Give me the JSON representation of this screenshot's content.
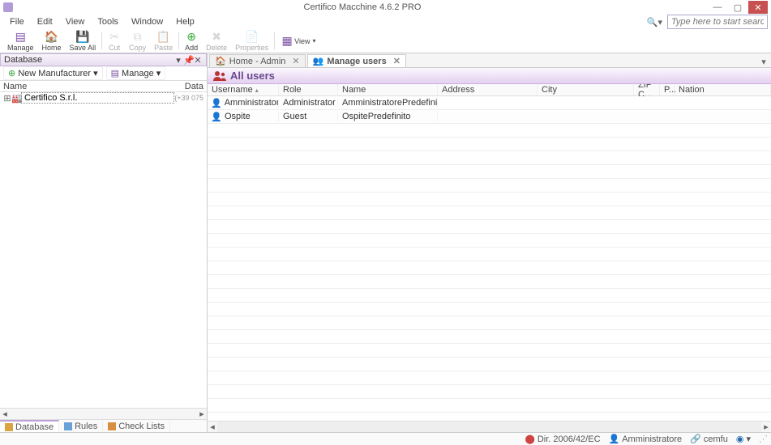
{
  "title": "Certifico Macchine 4.6.2 PRO",
  "menu": [
    "File",
    "Edit",
    "View",
    "Tools",
    "Window",
    "Help"
  ],
  "search": {
    "placeholder": "Type here to start searching"
  },
  "toolbar": [
    {
      "key": "manage",
      "label": "Manage",
      "icon": "list",
      "color": "#7a4fa3"
    },
    {
      "key": "home",
      "label": "Home",
      "icon": "home",
      "color": "#888"
    },
    {
      "key": "saveall",
      "label": "Save All",
      "icon": "disks",
      "color": "#7a4fa3"
    },
    {
      "key": "sep"
    },
    {
      "key": "cut",
      "label": "Cut",
      "icon": "cut",
      "color": "#aaa",
      "disabled": true
    },
    {
      "key": "copy",
      "label": "Copy",
      "icon": "copy",
      "color": "#aaa",
      "disabled": true
    },
    {
      "key": "paste",
      "label": "Paste",
      "icon": "paste",
      "color": "#aaa",
      "disabled": true
    },
    {
      "key": "sep"
    },
    {
      "key": "add",
      "label": "Add",
      "icon": "plus",
      "color": "#3a3"
    },
    {
      "key": "delete",
      "label": "Delete",
      "icon": "x",
      "color": "#aaa",
      "disabled": true
    },
    {
      "key": "properties",
      "label": "Properties",
      "icon": "props",
      "color": "#aaa",
      "disabled": true
    },
    {
      "key": "sep"
    },
    {
      "key": "view",
      "label": "View",
      "icon": "grid",
      "color": "#7a4fa3",
      "dd": true
    }
  ],
  "leftPanel": {
    "title": "Database",
    "sub": {
      "newmfr": "New Manufacturer",
      "manage": "Manage"
    },
    "cols": {
      "name": "Name",
      "data": "Data"
    },
    "tree": [
      {
        "label": "Certifico S.r.l.",
        "data": "(+39 075"
      }
    ],
    "tabs": [
      {
        "key": "database",
        "label": "Database",
        "active": true,
        "color": "#d9a441"
      },
      {
        "key": "rules",
        "label": "Rules",
        "active": false,
        "color": "#6aa0d8"
      },
      {
        "key": "checklists",
        "label": "Check Lists",
        "active": false,
        "color": "#d98f41"
      }
    ]
  },
  "docTabs": [
    {
      "key": "home",
      "label": "Home - Admin",
      "icon": "home",
      "active": false
    },
    {
      "key": "users",
      "label": "Manage users",
      "icon": "users",
      "active": true
    }
  ],
  "section": {
    "title": "All users"
  },
  "grid": {
    "columns": [
      "Username",
      "Role",
      "Name",
      "Address",
      "City",
      "ZIP C...",
      "P...",
      "Nation"
    ],
    "rows": [
      {
        "username": "Amministratore",
        "role": "Administrator",
        "name": "AmministratorePredefinito"
      },
      {
        "username": "Ospite",
        "role": "Guest",
        "name": "OspitePredefinito"
      }
    ]
  },
  "status": {
    "directive": "Dir. 2006/42/EC",
    "user": "Amministratore",
    "server": "cemfu"
  }
}
